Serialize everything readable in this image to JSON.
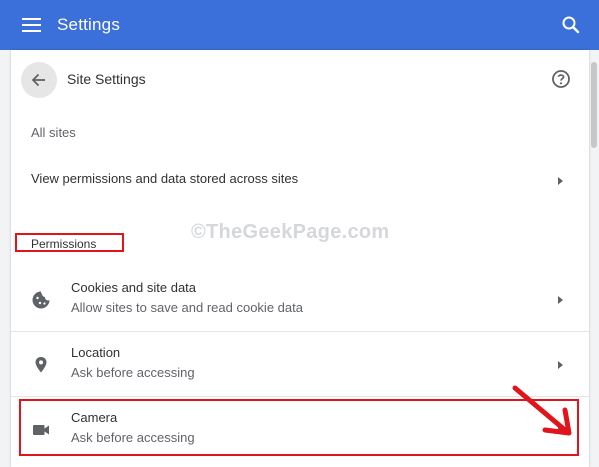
{
  "appbar": {
    "title": "Settings"
  },
  "header": {
    "title": "Site Settings"
  },
  "all_sites": {
    "label": "All sites",
    "row_text": "View permissions and data stored across sites"
  },
  "permissions": {
    "label": "Permissions",
    "items": [
      {
        "icon": "cookie-icon",
        "title": "Cookies and site data",
        "subtitle": "Allow sites to save and read cookie data"
      },
      {
        "icon": "location-pin-icon",
        "title": "Location",
        "subtitle": "Ask before accessing"
      },
      {
        "icon": "camera-icon",
        "title": "Camera",
        "subtitle": "Ask before accessing"
      }
    ]
  },
  "watermark": "©TheGeekPage.com",
  "colors": {
    "appbar": "#3b6fd9",
    "highlight": "#e0141a"
  }
}
